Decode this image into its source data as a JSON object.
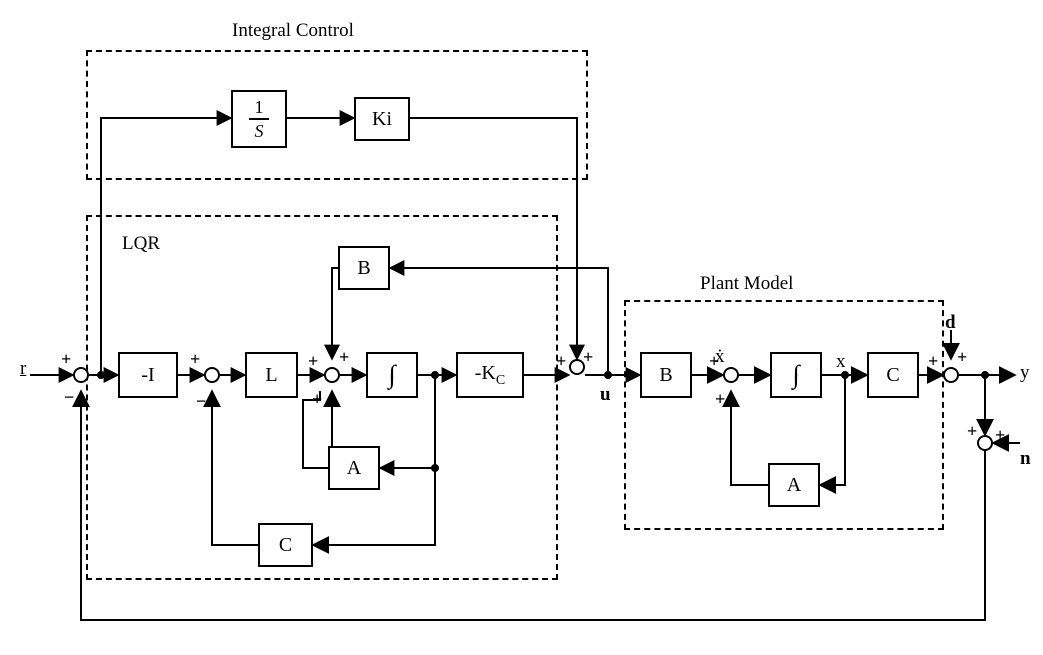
{
  "signals": {
    "r": "r",
    "u": "u",
    "y": "y",
    "d": "d",
    "n": "n",
    "x": "x",
    "xdot": "ẋ"
  },
  "sections": {
    "integral": "Integral Control",
    "lqr": "LQR",
    "plant": "Plant Model"
  },
  "blocks": {
    "invS_num": "1",
    "invS_den": "S",
    "Ki": "Ki",
    "negI": "-I",
    "L": "L",
    "B_lqr": "B",
    "integ_lqr": "∫",
    "negKc_pre": "-K",
    "negKc_sub": "C",
    "A_lqr": "A",
    "C_lqr": "C",
    "B_plant": "B",
    "integ_plant": "∫",
    "C_plant": "C",
    "A_plant": "A"
  },
  "signs": {
    "plus": "+",
    "minus": "−"
  },
  "diagram": {
    "type": "block-diagram",
    "description": "LQR state-feedback with Luenberger observer, integral tracking compensator, and LTI plant model with disturbance d and noise n inputs.",
    "blocks": [
      {
        "id": "sum_r",
        "kind": "sum",
        "signs": {
          "r": "+",
          "y_fb": "-"
        }
      },
      {
        "id": "tee_err",
        "kind": "node"
      },
      {
        "id": "invS",
        "kind": "integrator-1-over-s"
      },
      {
        "id": "Ki",
        "kind": "gain",
        "value": "Ki"
      },
      {
        "id": "negI",
        "kind": "gain",
        "value": "-I"
      },
      {
        "id": "sum_obs_in",
        "kind": "sum",
        "signs": {
          "from_negI": "+",
          "from_Cx_hat": "-"
        }
      },
      {
        "id": "L",
        "kind": "gain",
        "value": "L"
      },
      {
        "id": "sum_obs",
        "kind": "sum",
        "signs": {
          "from_L": "+",
          "from_Ax_hat": "+",
          "from_Bu": "+"
        }
      },
      {
        "id": "integ_obs",
        "kind": "integrator"
      },
      {
        "id": "tee_xhat",
        "kind": "node"
      },
      {
        "id": "negKc",
        "kind": "gain",
        "value": "-K_C"
      },
      {
        "id": "A_obs",
        "kind": "gain",
        "value": "A"
      },
      {
        "id": "C_obs",
        "kind": "gain",
        "value": "C"
      },
      {
        "id": "B_obs",
        "kind": "gain",
        "value": "B"
      },
      {
        "id": "sum_u",
        "kind": "sum",
        "signs": {
          "from_Ki": "+",
          "from_negKc": "+"
        }
      },
      {
        "id": "tee_u",
        "kind": "node"
      },
      {
        "id": "B_plant",
        "kind": "gain",
        "value": "B"
      },
      {
        "id": "sum_plant",
        "kind": "sum",
        "signs": {
          "from_B_plant": "+",
          "from_Ax": "+"
        }
      },
      {
        "id": "integ_plant",
        "kind": "integrator"
      },
      {
        "id": "tee_x",
        "kind": "node"
      },
      {
        "id": "C_plant",
        "kind": "gain",
        "value": "C"
      },
      {
        "id": "A_plant",
        "kind": "gain",
        "value": "A"
      },
      {
        "id": "sum_d",
        "kind": "sum",
        "signs": {
          "from_C_plant": "+",
          "from_d": "+"
        }
      },
      {
        "id": "sum_n",
        "kind": "sum",
        "signs": {
          "from_y": "+",
          "from_n": "+"
        }
      }
    ],
    "edges": [
      {
        "from": "r",
        "to": "sum_r"
      },
      {
        "from": "sum_r",
        "to": "tee_err"
      },
      {
        "from": "tee_err",
        "to": "invS"
      },
      {
        "from": "invS",
        "to": "Ki"
      },
      {
        "from": "Ki",
        "to": "sum_u",
        "port": "from_Ki"
      },
      {
        "from": "tee_err",
        "to": "negI"
      },
      {
        "from": "negI",
        "to": "sum_obs_in",
        "port": "from_negI"
      },
      {
        "from": "sum_obs_in",
        "to": "L"
      },
      {
        "from": "L",
        "to": "sum_obs",
        "port": "from_L"
      },
      {
        "from": "sum_obs",
        "to": "integ_obs"
      },
      {
        "from": "integ_obs",
        "to": "tee_xhat"
      },
      {
        "from": "tee_xhat",
        "to": "negKc"
      },
      {
        "from": "negKc",
        "to": "sum_u",
        "port": "from_negKc"
      },
      {
        "from": "tee_xhat",
        "to": "A_obs"
      },
      {
        "from": "A_obs",
        "to": "sum_obs",
        "port": "from_Ax_hat"
      },
      {
        "from": "tee_xhat",
        "to": "C_obs"
      },
      {
        "from": "C_obs",
        "to": "sum_obs_in",
        "port": "from_Cx_hat"
      },
      {
        "from": "sum_u",
        "to": "tee_u"
      },
      {
        "from": "tee_u",
        "to": "B_plant"
      },
      {
        "from": "tee_u",
        "to": "B_obs"
      },
      {
        "from": "B_obs",
        "to": "sum_obs",
        "port": "from_Bu"
      },
      {
        "from": "B_plant",
        "to": "sum_plant",
        "port": "from_B_plant"
      },
      {
        "from": "sum_plant",
        "to": "integ_plant"
      },
      {
        "from": "integ_plant",
        "to": "tee_x"
      },
      {
        "from": "tee_x",
        "to": "C_plant"
      },
      {
        "from": "tee_x",
        "to": "A_plant"
      },
      {
        "from": "A_plant",
        "to": "sum_plant",
        "port": "from_Ax"
      },
      {
        "from": "C_plant",
        "to": "sum_d",
        "port": "from_C_plant"
      },
      {
        "from": "d",
        "to": "sum_d",
        "port": "from_d"
      },
      {
        "from": "sum_d",
        "to": "y"
      },
      {
        "from": "sum_d",
        "to": "sum_n",
        "port": "from_y"
      },
      {
        "from": "n",
        "to": "sum_n",
        "port": "from_n"
      },
      {
        "from": "sum_n",
        "to": "sum_r",
        "port": "y_fb"
      }
    ]
  }
}
